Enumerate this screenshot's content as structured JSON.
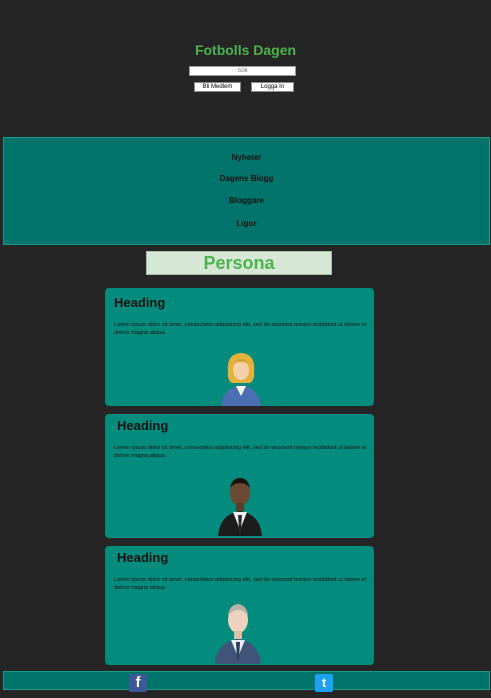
{
  "header": {
    "title": "Fotbolls Dagen",
    "search_placeholder": "Sök",
    "become_member_label": "Bli Medlem",
    "login_label": "Logga In"
  },
  "nav": {
    "items": [
      {
        "label": "Nyheter"
      },
      {
        "label": "Dagens Blogg"
      },
      {
        "label": "Bloggare"
      },
      {
        "label": "Ligor"
      }
    ]
  },
  "section": {
    "title": "Persona"
  },
  "cards": [
    {
      "heading": "Heading",
      "text": "Lorem ipsum dolor sit amet, consectetur adipisicing elit, sed do eiusmod tempor incididunt ut labore et dolore magna aliqua.",
      "avatar_icon": "businesswoman-avatar-icon"
    },
    {
      "heading": "Heading",
      "text": "Lorem ipsum dolor sit amet, consectetur adipisicing elit, sed do eiusmod tempor incididunt ut labore et dolore magna aliqua.",
      "avatar_icon": "businessman-dark-avatar-icon"
    },
    {
      "heading": "Heading",
      "text": "Lorem ipsum dolor sit amet, consectetur adipisicing elit, sed do eiusmod tempor incididunt ut labore et dolore magna aliqua.",
      "avatar_icon": "businessman-grey-avatar-icon"
    }
  ],
  "footer": {
    "facebook_icon": "facebook-icon",
    "twitter_icon": "twitter-icon",
    "facebook_glyph": "f",
    "twitter_glyph": "t"
  },
  "colors": {
    "background": "#252525",
    "accent_green": "#4db34d",
    "teal_dark": "#00746a",
    "teal_card": "#038c7d",
    "persona_bg": "#d6e7d6",
    "facebook_blue": "#3b5998",
    "twitter_blue": "#1da1f2"
  }
}
